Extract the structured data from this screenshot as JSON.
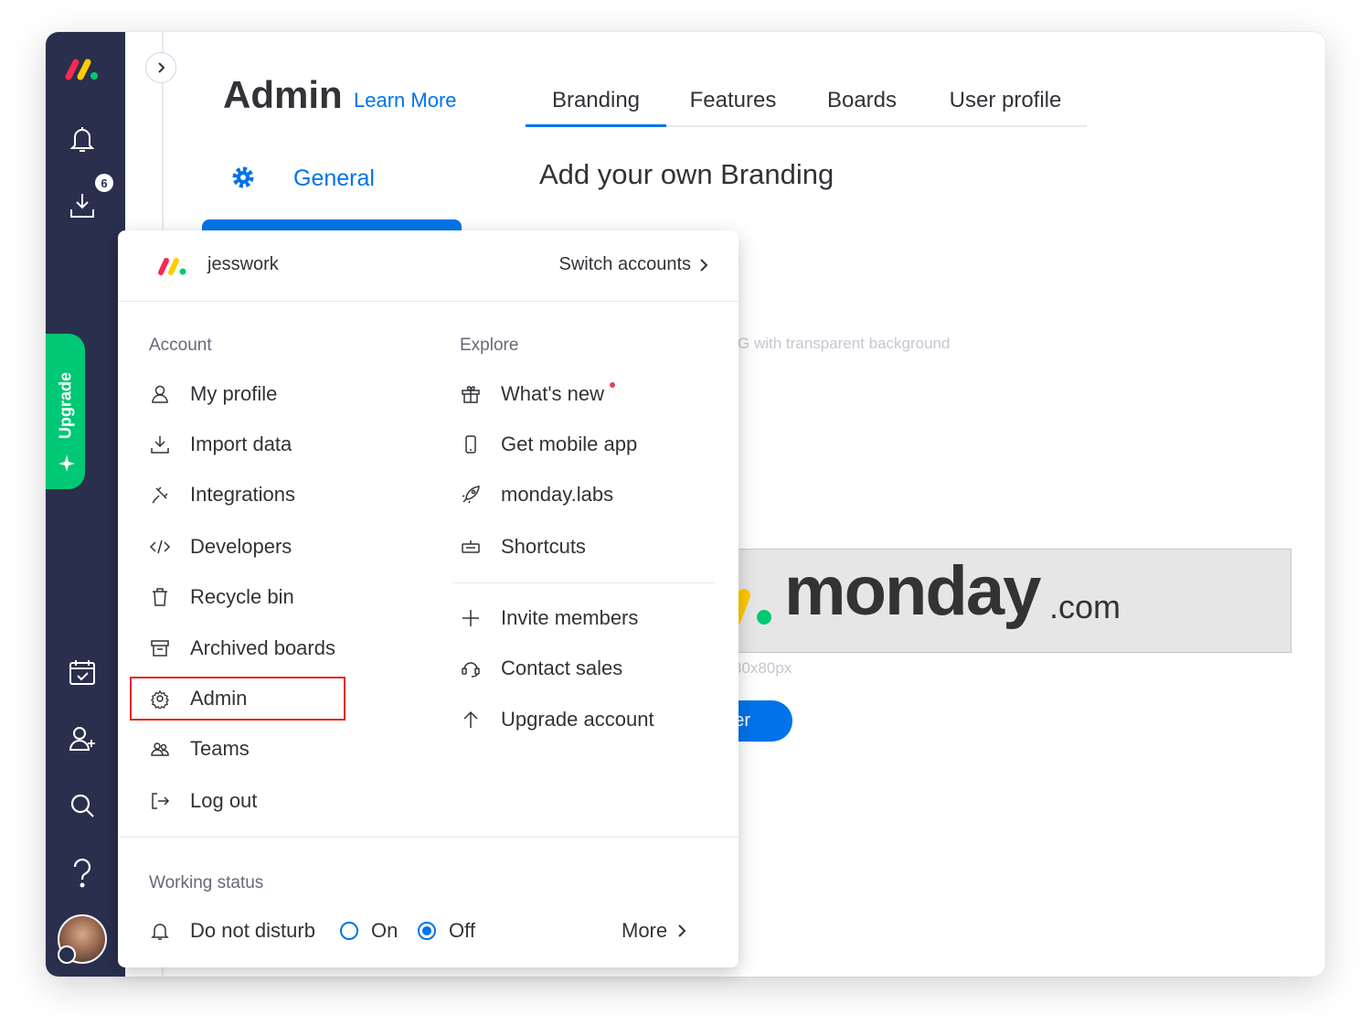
{
  "rail": {
    "inbox_badge": "6",
    "upgrade_label": "Upgrade"
  },
  "header": {
    "title": "Admin",
    "learn_more": "Learn More",
    "tabs": [
      {
        "label": "Branding",
        "active": true
      },
      {
        "label": "Features",
        "active": false
      },
      {
        "label": "Boards",
        "active": false
      },
      {
        "label": "User profile",
        "active": false
      }
    ]
  },
  "sidebar": {
    "general_label": "General"
  },
  "branding": {
    "title": "Add your own Branding",
    "format_hint": "G with transparent background",
    "logo_word": "monday",
    "logo_suffix": ".com",
    "size_hint": "30x80px",
    "upload_button": "der"
  },
  "menu": {
    "account_name": "jesswork",
    "switch_accounts": "Switch accounts",
    "account_title": "Account",
    "account_items": [
      {
        "label": "My profile",
        "icon": "person-icon"
      },
      {
        "label": "Import data",
        "icon": "import-icon"
      },
      {
        "label": "Integrations",
        "icon": "integrations-icon"
      },
      {
        "label": "Developers",
        "icon": "code-icon"
      },
      {
        "label": "Recycle bin",
        "icon": "trash-icon"
      },
      {
        "label": "Archived boards",
        "icon": "archive-icon"
      },
      {
        "label": "Admin",
        "icon": "gear-icon"
      },
      {
        "label": "Teams",
        "icon": "teams-icon"
      },
      {
        "label": "Log out",
        "icon": "logout-icon"
      }
    ],
    "explore_title": "Explore",
    "explore_items": [
      {
        "label": "What's new",
        "icon": "gift-icon"
      },
      {
        "label": "Get mobile app",
        "icon": "mobile-icon"
      },
      {
        "label": "monday.labs",
        "icon": "rocket-icon"
      },
      {
        "label": "Shortcuts",
        "icon": "keyboard-icon"
      }
    ],
    "more_items": [
      {
        "label": "Invite members",
        "icon": "plus-icon"
      },
      {
        "label": "Contact sales",
        "icon": "headset-icon"
      },
      {
        "label": "Upgrade account",
        "icon": "arrow-up-icon"
      }
    ],
    "working_status_title": "Working status",
    "dnd_label": "Do not disturb",
    "on_label": "On",
    "off_label": "Off",
    "dnd_selected": "Off",
    "more_label": "More"
  },
  "colors": {
    "rail": "#292f4c",
    "accent": "#0073ea",
    "upgrade": "#00c875",
    "highlight": "#e2291c"
  }
}
